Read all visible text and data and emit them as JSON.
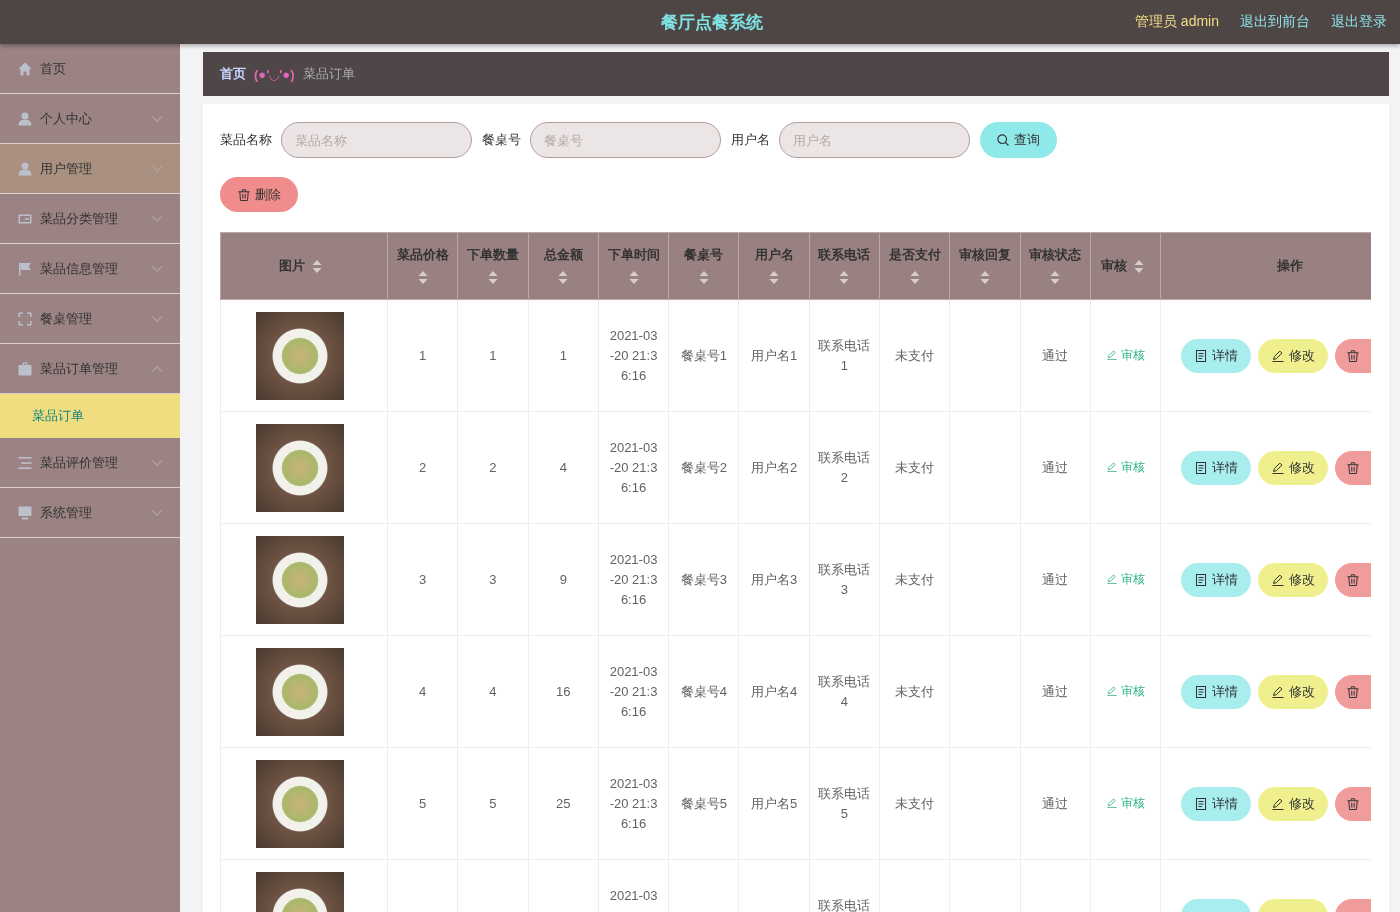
{
  "header": {
    "title": "餐厅点餐系统",
    "user": "管理员 admin",
    "links": [
      "退出到前台",
      "退出登录"
    ]
  },
  "sidebar": {
    "items": [
      {
        "kind": "link",
        "label": "首页",
        "hovered": false
      },
      {
        "kind": "menu",
        "label": "个人中心",
        "expanded": false,
        "hovered": false
      },
      {
        "kind": "menu",
        "label": "用户管理",
        "expanded": false,
        "hovered": true
      },
      {
        "kind": "menu",
        "label": "菜品分类管理",
        "expanded": false,
        "hovered": false
      },
      {
        "kind": "menu",
        "label": "菜品信息管理",
        "expanded": false,
        "hovered": false
      },
      {
        "kind": "menu",
        "label": "餐桌管理",
        "expanded": false,
        "hovered": false
      },
      {
        "kind": "menu",
        "label": "菜品订单管理",
        "expanded": true,
        "hovered": false,
        "children": [
          {
            "label": "菜品订单",
            "selected": true
          }
        ]
      },
      {
        "kind": "menu",
        "label": "菜品评价管理",
        "expanded": false,
        "hovered": false
      },
      {
        "kind": "menu",
        "label": "系统管理",
        "expanded": false,
        "hovered": false
      }
    ]
  },
  "breadcrumb": {
    "items": [
      "首页",
      "菜品订单"
    ],
    "separator": "(●'◡'●)"
  },
  "search": {
    "fields": [
      {
        "label": "菜品名称",
        "placeholder": "菜品名称"
      },
      {
        "label": "餐桌号",
        "placeholder": "餐桌号"
      },
      {
        "label": "用户名",
        "placeholder": "用户名"
      }
    ],
    "button": "查询"
  },
  "toolbar": {
    "buttons": [
      {
        "kind": "delete",
        "label": "删除"
      }
    ]
  },
  "table": {
    "columns": [
      {
        "label": "图片",
        "sortable": true
      },
      {
        "label": "菜品价格",
        "sortable": true
      },
      {
        "label": "下单数量",
        "sortable": true
      },
      {
        "label": "总金额",
        "sortable": true
      },
      {
        "label": "下单时间",
        "sortable": true
      },
      {
        "label": "餐桌号",
        "sortable": true
      },
      {
        "label": "用户名",
        "sortable": true
      },
      {
        "label": "联系电话",
        "sortable": true
      },
      {
        "label": "是否支付",
        "sortable": true
      },
      {
        "label": "审核回复",
        "sortable": true
      },
      {
        "label": "审核状态",
        "sortable": true
      },
      {
        "label": "审核",
        "sortable": true
      },
      {
        "label": "操作",
        "sortable": false
      }
    ],
    "rows": [
      {
        "price": "1",
        "quantity": "1",
        "total": "1",
        "order_time": "2021-03-20 21:36:16",
        "table_no": "餐桌号1",
        "username": "用户名1",
        "phone": "联系电话1",
        "paid": "未支付",
        "review_status": "通过",
        "review_action": "审核",
        "cut": false,
        "actions": [
          {
            "kind": "detail",
            "label": "详情"
          },
          {
            "kind": "edit",
            "label": "修改"
          },
          {
            "kind": "delete"
          }
        ]
      },
      {
        "price": "2",
        "quantity": "2",
        "total": "4",
        "order_time": "2021-03-20 21:36:16",
        "table_no": "餐桌号2",
        "username": "用户名2",
        "phone": "联系电话2",
        "paid": "未支付",
        "review_status": "通过",
        "review_action": "审核",
        "cut": false,
        "actions": [
          {
            "kind": "detail",
            "label": "详情"
          },
          {
            "kind": "edit",
            "label": "修改"
          },
          {
            "kind": "delete"
          }
        ]
      },
      {
        "price": "3",
        "quantity": "3",
        "total": "9",
        "order_time": "2021-03-20 21:36:16",
        "table_no": "餐桌号3",
        "username": "用户名3",
        "phone": "联系电话3",
        "paid": "未支付",
        "review_status": "通过",
        "review_action": "审核",
        "cut": false,
        "actions": [
          {
            "kind": "detail",
            "label": "详情"
          },
          {
            "kind": "edit",
            "label": "修改"
          },
          {
            "kind": "delete"
          }
        ]
      },
      {
        "price": "4",
        "quantity": "4",
        "total": "16",
        "order_time": "2021-03-20 21:36:16",
        "table_no": "餐桌号4",
        "username": "用户名4",
        "phone": "联系电话4",
        "paid": "未支付",
        "review_status": "通过",
        "review_action": "审核",
        "cut": false,
        "actions": [
          {
            "kind": "detail",
            "label": "详情"
          },
          {
            "kind": "edit",
            "label": "修改"
          },
          {
            "kind": "delete"
          }
        ]
      },
      {
        "price": "5",
        "quantity": "5",
        "total": "25",
        "order_time": "2021-03-20 21:36:16",
        "table_no": "餐桌号5",
        "username": "用户名5",
        "phone": "联系电话5",
        "paid": "未支付",
        "review_status": "通过",
        "review_action": "审核",
        "cut": false,
        "actions": [
          {
            "kind": "detail",
            "label": "详情"
          },
          {
            "kind": "edit",
            "label": "修改"
          },
          {
            "kind": "delete"
          }
        ]
      },
      {
        "order_time": "2021-03",
        "phone": "联系电话",
        "cut": true,
        "actions": [
          {
            "kind": "detail"
          },
          {
            "kind": "edit"
          },
          {
            "kind": "delete"
          }
        ]
      }
    ]
  }
}
